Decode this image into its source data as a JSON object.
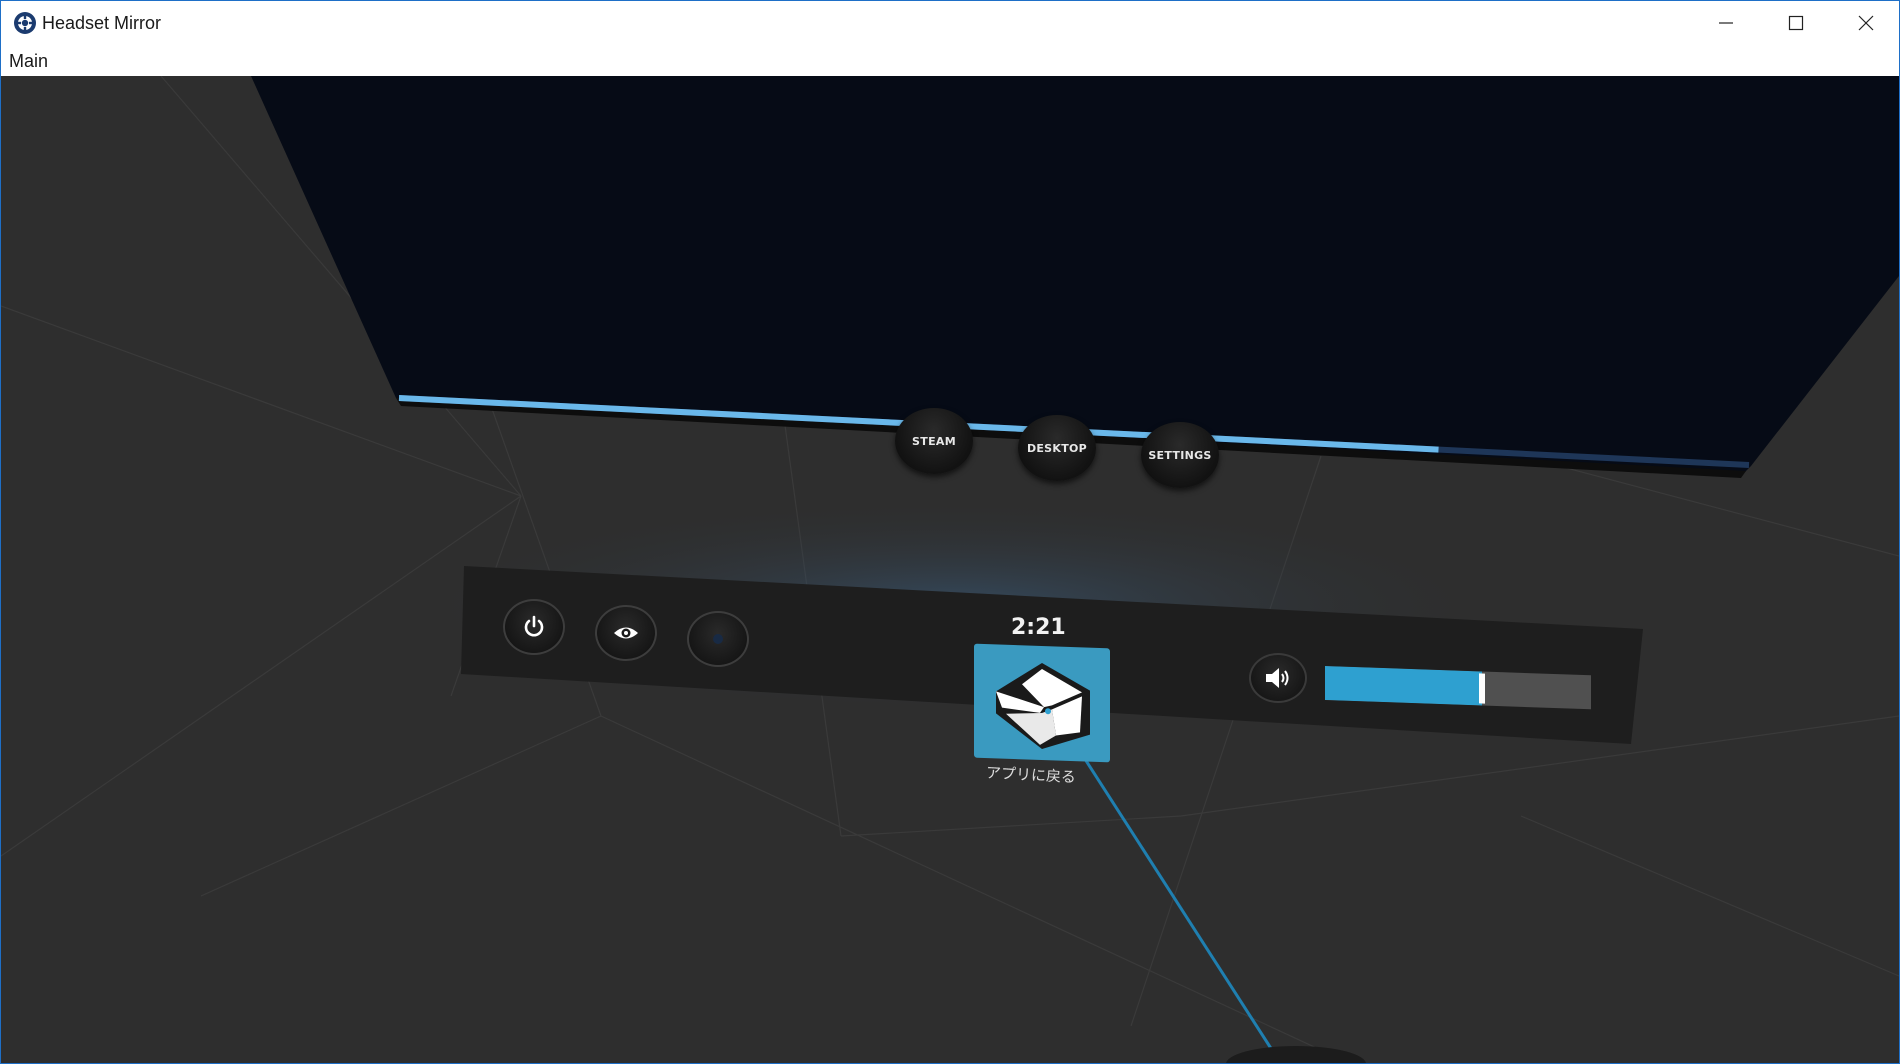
{
  "window": {
    "title": "Headset Mirror",
    "menu": [
      "Main"
    ]
  },
  "dashboard": {
    "buttons": [
      {
        "label": "STEAM"
      },
      {
        "label": "DESKTOP"
      },
      {
        "label": "SETTINGS"
      }
    ],
    "clock": "2:21",
    "tile_label": "アプリに戻る",
    "volume_level": 0.59,
    "progress_level": 0.77
  },
  "colors": {
    "accent": "#2ea0d0",
    "tile": "#3a9ac0",
    "screen": "#060b16",
    "floor": "#2e2e2e"
  }
}
